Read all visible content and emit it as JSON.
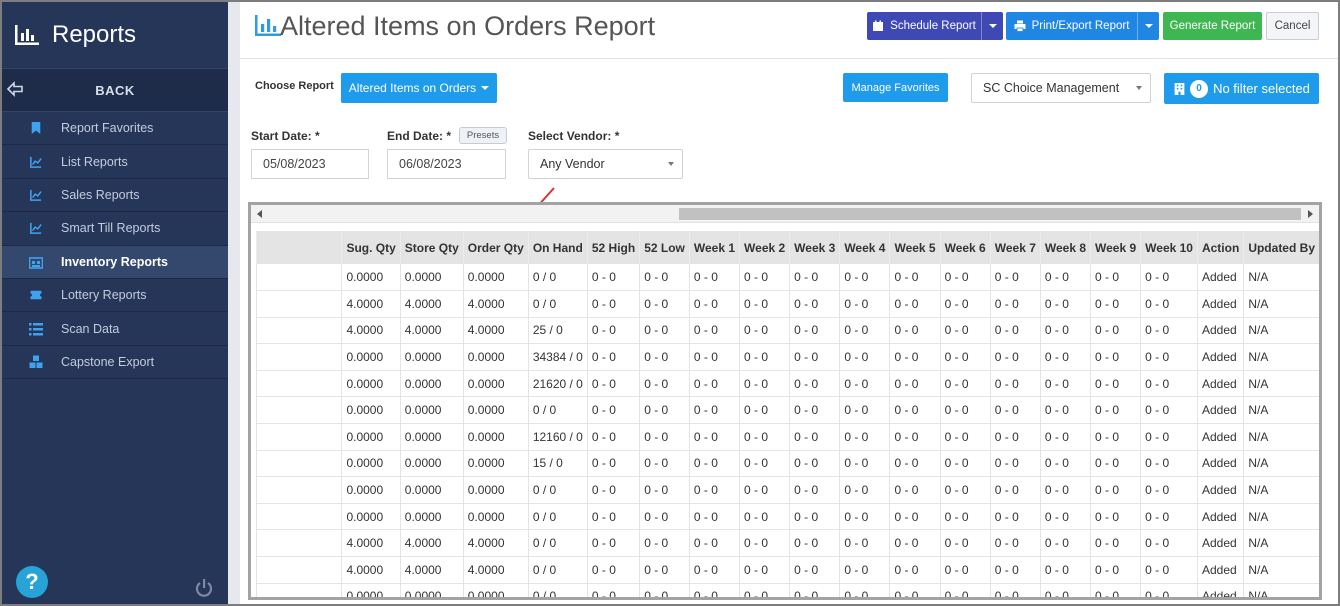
{
  "sidebar": {
    "title": "Reports",
    "back_label": "BACK",
    "items": [
      {
        "label": "Report Favorites",
        "icon": "bookmark-icon"
      },
      {
        "label": "List Reports",
        "icon": "chart-icon"
      },
      {
        "label": "Sales Reports",
        "icon": "chart-icon"
      },
      {
        "label": "Smart Till Reports",
        "icon": "chart-icon"
      },
      {
        "label": "Inventory Reports",
        "icon": "warehouse-icon"
      },
      {
        "label": "Lottery Reports",
        "icon": "ticket-icon"
      },
      {
        "label": "Scan Data",
        "icon": "list-icon"
      },
      {
        "label": "Capstone Export",
        "icon": "cubes-icon"
      }
    ],
    "active_index": 4
  },
  "header": {
    "title": "Altered Items on Orders Report",
    "schedule_label": "Schedule Report",
    "print_label": "Print/Export Report",
    "generate_label": "Generate Report",
    "cancel_label": "Cancel"
  },
  "controls": {
    "choose_label": "Choose Report",
    "choose_value": "Altered Items on Orders",
    "favorites_label": "Manage Favorites",
    "management_value": "SC Choice Management",
    "filter_count": "0",
    "filter_label": "No filter selected"
  },
  "filters": {
    "start_label": "Start Date: *",
    "start_value": "05/08/2023",
    "end_label": "End Date: *",
    "presets_label": "Presets",
    "end_value": "06/08/2023",
    "vendor_label": "Select Vendor: *",
    "vendor_value": "Any Vendor"
  },
  "table": {
    "columns": [
      "",
      "Sug. Qty",
      "Store Qty",
      "Order Qty",
      "On Hand",
      "52 High",
      "52 Low",
      "Week 1",
      "Week 2",
      "Week 3",
      "Week 4",
      "Week 5",
      "Week 6",
      "Week 7",
      "Week 8",
      "Week 9",
      "Week 10",
      "Action",
      "Updated By"
    ],
    "rows": [
      [
        "0.0000",
        "0.0000",
        "0.0000",
        "0 / 0"
      ],
      [
        "4.0000",
        "4.0000",
        "4.0000",
        "0 / 0"
      ],
      [
        "4.0000",
        "4.0000",
        "4.0000",
        "25 / 0"
      ],
      [
        "0.0000",
        "0.0000",
        "0.0000",
        "34384 / 0"
      ],
      [
        "0.0000",
        "0.0000",
        "0.0000",
        "21620 / 0"
      ],
      [
        "0.0000",
        "0.0000",
        "0.0000",
        "0 / 0"
      ],
      [
        "0.0000",
        "0.0000",
        "0.0000",
        "12160 / 0"
      ],
      [
        "0.0000",
        "0.0000",
        "0.0000",
        "15 / 0"
      ],
      [
        "0.0000",
        "0.0000",
        "0.0000",
        "0 / 0"
      ],
      [
        "0.0000",
        "0.0000",
        "0.0000",
        "0 / 0"
      ],
      [
        "4.0000",
        "4.0000",
        "4.0000",
        "0 / 0"
      ],
      [
        "4.0000",
        "4.0000",
        "4.0000",
        "0 / 0"
      ],
      [
        "0.0000",
        "0.0000",
        "0.0000",
        "0 / 0"
      ]
    ],
    "week_value": "0 - 0",
    "action_value": "Added",
    "updated_value": "N/A"
  }
}
